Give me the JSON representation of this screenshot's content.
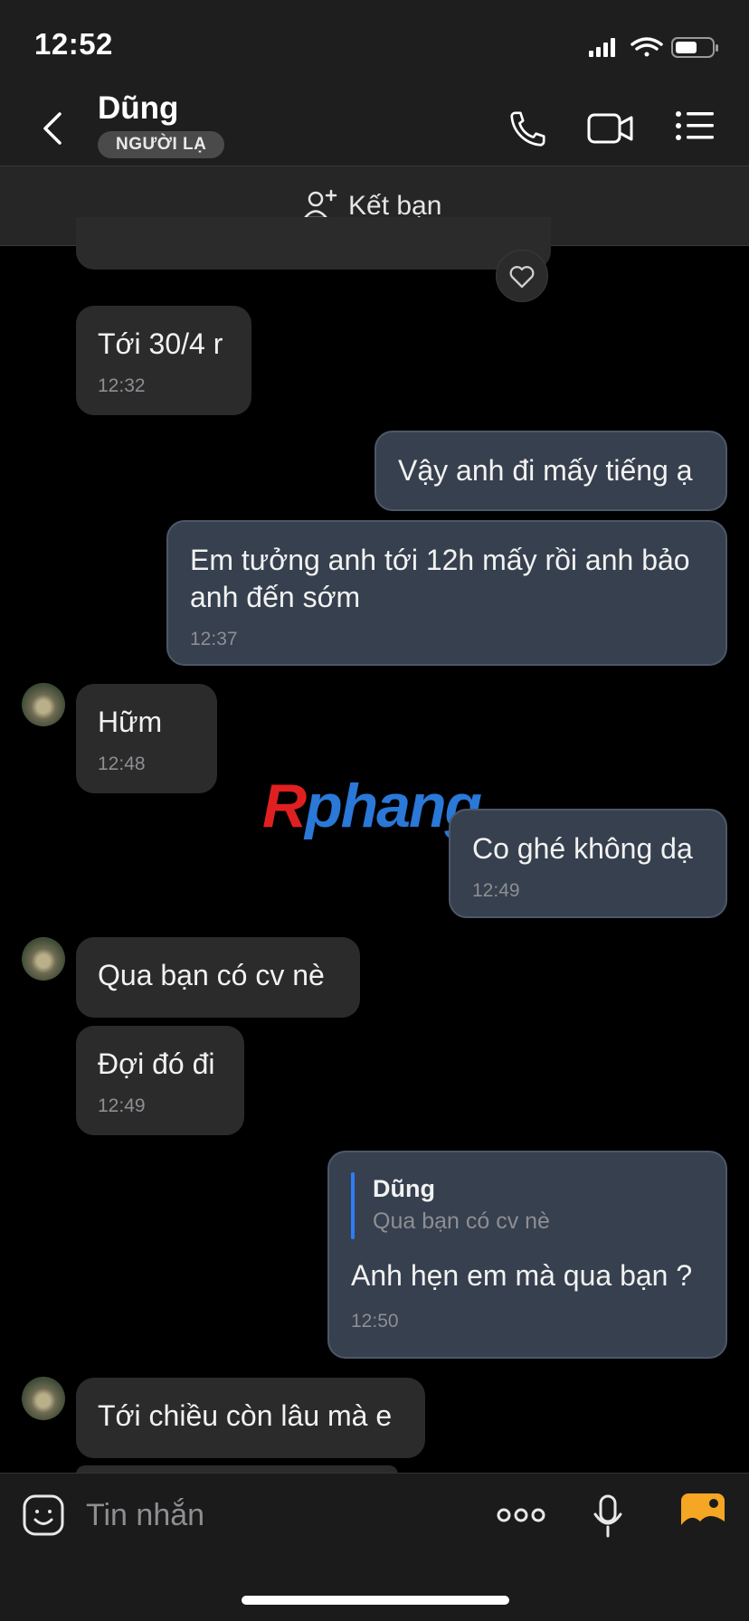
{
  "status_bar": {
    "time": "12:52"
  },
  "header": {
    "contact_name": "Dũng",
    "badge": "NGƯỜI LẠ"
  },
  "add_friend": {
    "label": "Kết bạn"
  },
  "messages": [
    {
      "text": "Tới 30/4 r",
      "time": "12:32",
      "direction": "incoming"
    },
    {
      "text": "Vậy anh đi mấy tiếng ạ",
      "direction": "outgoing"
    },
    {
      "text": "Em tưởng anh tới 12h mấy rồi anh bảo anh đến sớm",
      "time": "12:37",
      "direction": "outgoing"
    },
    {
      "text": "Hữm",
      "time": "12:48",
      "direction": "incoming"
    },
    {
      "text": "Co ghé không dạ",
      "time": "12:49",
      "direction": "outgoing"
    },
    {
      "text": "Qua bạn có cv nè",
      "direction": "incoming"
    },
    {
      "text": "Đợi đó đi",
      "time": "12:49",
      "direction": "incoming"
    },
    {
      "reply_to_name": "Dũng",
      "reply_to_text": "Qua bạn có cv nè",
      "text": "Anh hẹn em mà qua bạn ?",
      "time": "12:50",
      "direction": "outgoing"
    },
    {
      "text": "Tới chiều còn lâu mà e",
      "direction": "incoming"
    }
  ],
  "watermark": {
    "part1": "R",
    "part2": "phang"
  },
  "composer": {
    "placeholder": "Tin nhắn"
  },
  "icons": {
    "back": "chevron-left-icon",
    "call": "phone-icon",
    "video": "video-camera-icon",
    "menu": "list-menu-icon",
    "add_friend": "add-user-icon",
    "sticker": "sticker-icon",
    "more": "more-icon",
    "mic": "microphone-icon",
    "photo": "photo-icon"
  },
  "colors": {
    "outgoing_bubble": "#36404e",
    "incoming_bubble": "#2b2b2c",
    "reply_accent": "#2f7bf5",
    "photo_icon": "#f5a623"
  }
}
